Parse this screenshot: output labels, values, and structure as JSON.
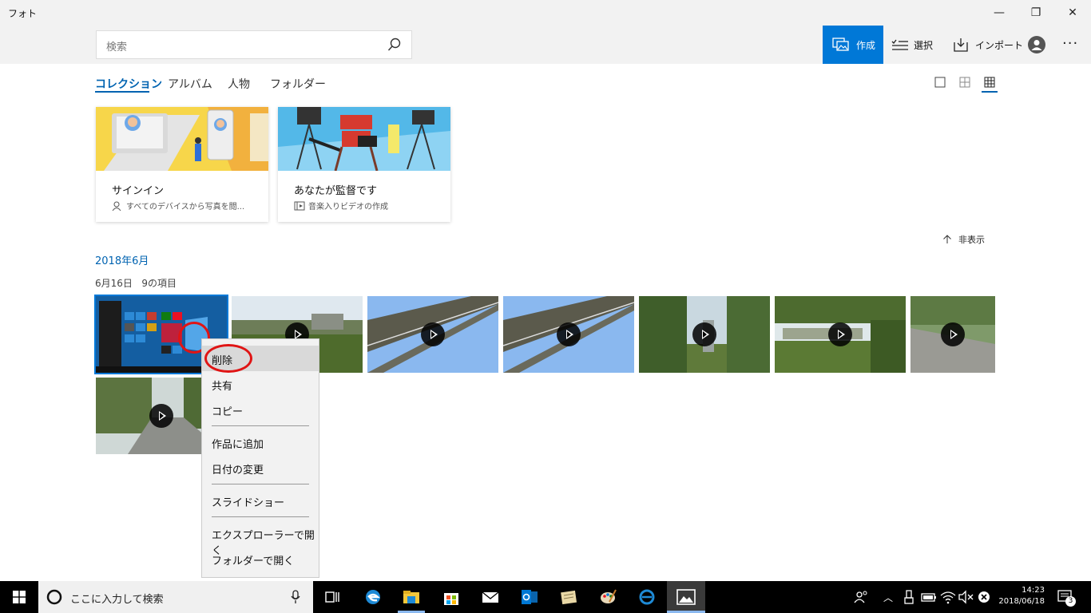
{
  "app": {
    "title": "フォト"
  },
  "window_controls": {
    "minimize": "—",
    "restore": "❐",
    "close": "✕"
  },
  "search": {
    "placeholder": "検索"
  },
  "toolbar": {
    "create": "作成",
    "select": "選択",
    "import": "インポート",
    "more": "···"
  },
  "tabs": [
    {
      "label": "コレクション",
      "active": true
    },
    {
      "label": "アルバム"
    },
    {
      "label": "人物"
    },
    {
      "label": "フォルダー"
    }
  ],
  "cards": [
    {
      "title": "サインイン",
      "subtitle": "すべてのデバイスから写真を閲..."
    },
    {
      "title": "あなたが監督です",
      "subtitle": "音楽入りビデオの作成"
    }
  ],
  "hide_label": "非表示",
  "section": {
    "month": "2018年6月",
    "day": "6月16日",
    "count": "9の項目"
  },
  "context_menu": {
    "items": [
      "削除",
      "共有",
      "コピー",
      "作品に追加",
      "日付の変更",
      "スライドショー",
      "エクスプローラーで開く",
      "フォルダーで開く"
    ],
    "highlighted": "削除"
  },
  "taskbar": {
    "search_placeholder": "ここに入力して検索",
    "time": "14:23",
    "date": "2018/06/18",
    "notifications": "3"
  },
  "colors": {
    "accent": "#0078d7",
    "link": "#0063b1",
    "annotation": "#e01414"
  }
}
